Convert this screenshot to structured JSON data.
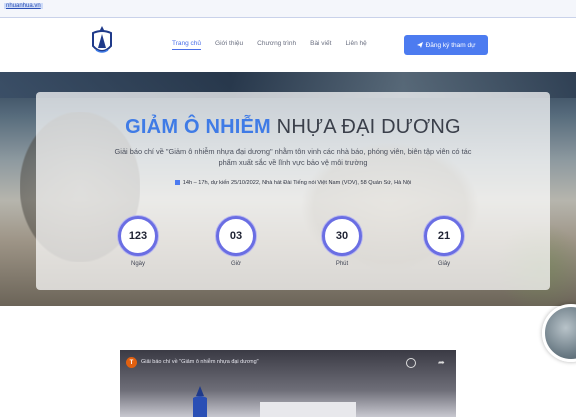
{
  "browser": {
    "url": "nhuanhua.vn"
  },
  "nav": {
    "menu": [
      "Trang chủ",
      "Giới thiệu",
      "Chương trình",
      "Bài viết",
      "Liên hệ"
    ],
    "register_label": "Đăng ký tham dự"
  },
  "hero": {
    "title_highlight": "GIẢM Ô NHIỄM",
    "title_rest": "NHỰA ĐẠI DƯƠNG",
    "description": "Giải báo chí về \"Giảm ô nhiễm nhựa đại dương\" nhằm tôn vinh các nhà báo, phóng viên, biên tập viên có tác phẩm xuất sắc về lĩnh vực bảo vệ môi trường",
    "event_info": "14h – 17h, dự kiến 25/10/2022, Nhà hát Đài Tiếng nói Việt Nam (VOV), 58 Quán Sứ, Hà Nội",
    "countdown": [
      {
        "value": "123",
        "label": "Ngày"
      },
      {
        "value": "03",
        "label": "Giờ"
      },
      {
        "value": "30",
        "label": "Phút"
      },
      {
        "value": "21",
        "label": "Giây"
      }
    ]
  },
  "video": {
    "channel_initial": "T",
    "title": "Giải báo chí về \"Giảm ô nhiễm nhựa đại dương\""
  },
  "colors": {
    "accent": "#3f7be6",
    "button": "#4c7bf0",
    "ring": "#6a6ee3"
  }
}
